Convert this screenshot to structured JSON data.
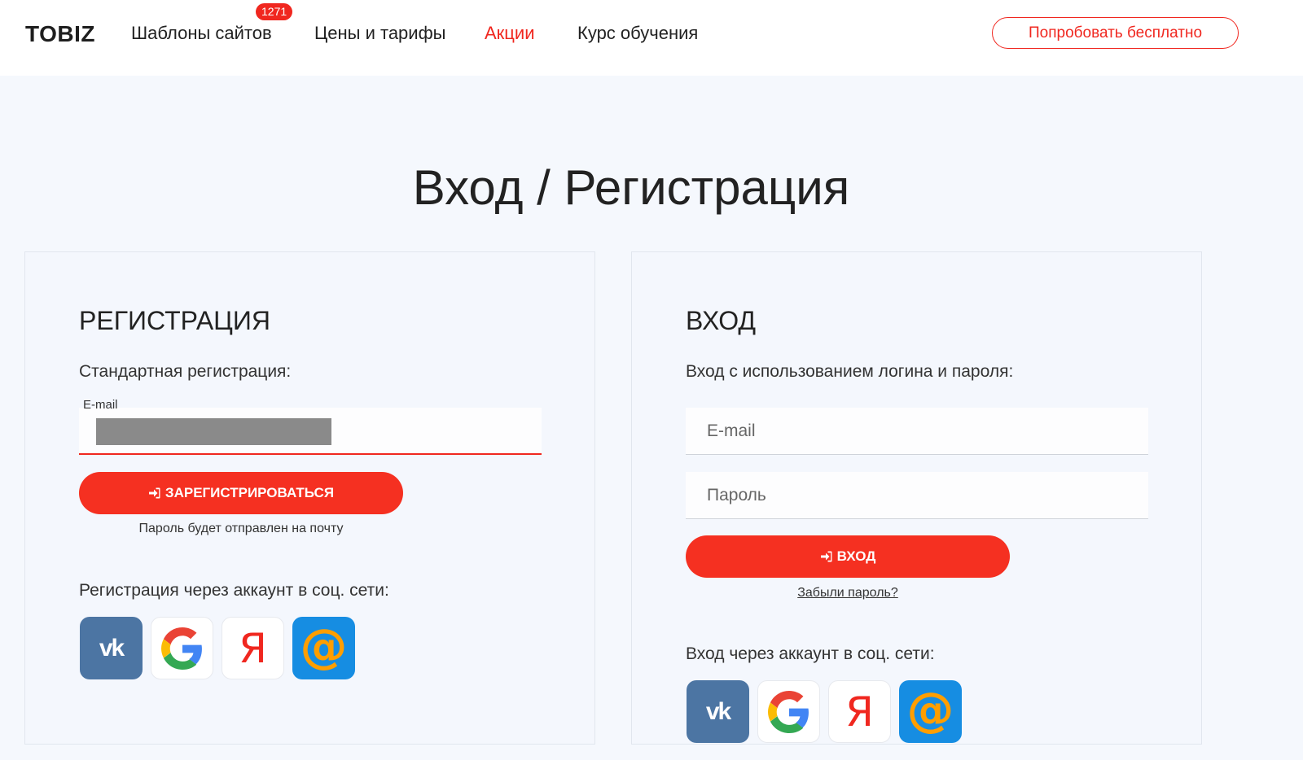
{
  "header": {
    "logo": "TOBIZ",
    "nav": [
      {
        "label": "Шаблоны сайтов",
        "badge": "1271"
      },
      {
        "label": "Цены и тарифы"
      },
      {
        "label": "Акции",
        "active": true
      },
      {
        "label": "Курс обучения"
      }
    ],
    "cta_label": "Попробовать бесплатно"
  },
  "page": {
    "title": "Вход / Регистрация"
  },
  "registration": {
    "heading": "РЕГИСТРАЦИЯ",
    "subtitle": "Стандартная регистрация:",
    "email_label": "E-mail",
    "submit_label": "ЗАРЕГИСТРИРОВАТЬСЯ",
    "hint": "Пароль будет отправлен на почту",
    "social_label": "Регистрация через аккаунт в соц. сети:"
  },
  "login": {
    "heading": "ВХОД",
    "subtitle": "Вход с использованием логина и пароля:",
    "email_placeholder": "E-mail",
    "password_placeholder": "Пароль",
    "submit_label": "ВХОД",
    "forgot_label": "Забыли пароль?",
    "social_label": "Вход через аккаунт в соц. сети:"
  },
  "social": {
    "vk_glyph": "vk",
    "yandex_glyph": "Я",
    "mail_glyph": "@",
    "icons": [
      "vk-icon",
      "google-icon",
      "yandex-icon",
      "mailru-icon"
    ]
  },
  "colors": {
    "accent": "#f0271f",
    "button": "#f53021",
    "vk": "#4c75a3",
    "mail": "#168de2",
    "mail_at": "#ff9e00"
  }
}
